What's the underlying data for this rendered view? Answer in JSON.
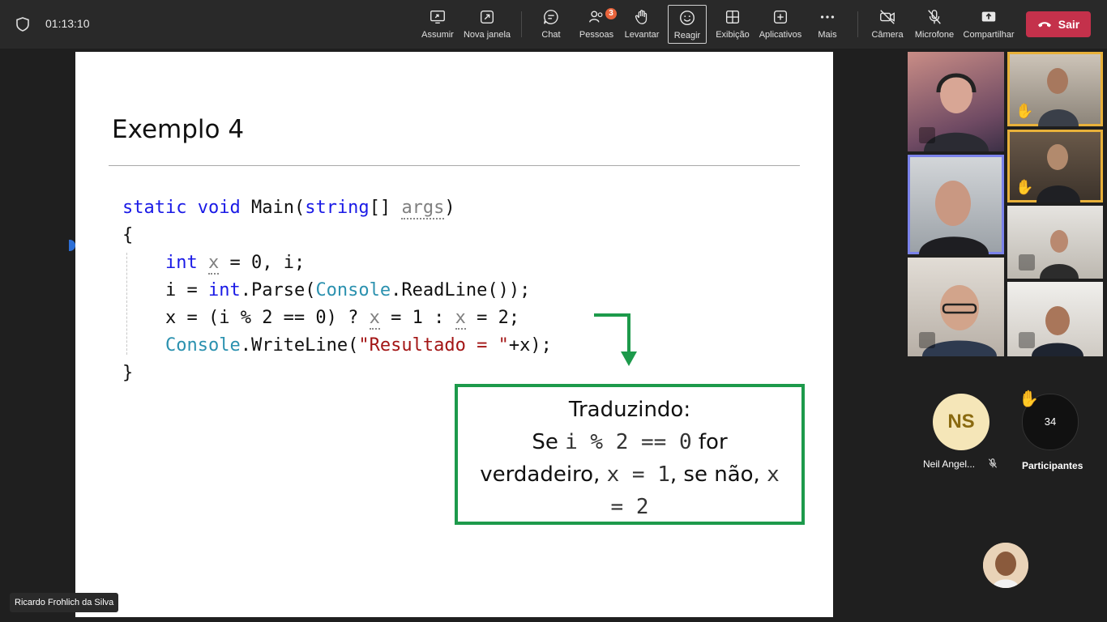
{
  "topbar": {
    "timer": "01:13:10",
    "buttons": [
      {
        "key": "assumir",
        "label": "Assumir",
        "icon": "share-screen-icon"
      },
      {
        "key": "nova_janela",
        "label": "Nova janela",
        "icon": "new-window-icon"
      },
      {
        "key": "chat",
        "label": "Chat",
        "icon": "chat-icon"
      },
      {
        "key": "pessoas",
        "label": "Pessoas",
        "icon": "people-icon",
        "badge": "3"
      },
      {
        "key": "levantar",
        "label": "Levantar",
        "icon": "raise-hand-icon"
      },
      {
        "key": "reagir",
        "label": "Reagir",
        "icon": "smiley-icon"
      },
      {
        "key": "exibicao",
        "label": "Exibição",
        "icon": "grid-icon"
      },
      {
        "key": "aplicativos",
        "label": "Aplicativos",
        "icon": "plus-box-icon"
      },
      {
        "key": "mais",
        "label": "Mais",
        "icon": "more-icon"
      },
      {
        "key": "camera",
        "label": "Câmera",
        "icon": "camera-off-icon"
      },
      {
        "key": "microfone",
        "label": "Microfone",
        "icon": "mic-off-icon"
      },
      {
        "key": "compartilhar",
        "label": "Compartilhar",
        "icon": "share-icon"
      }
    ],
    "leave_label": "Sair",
    "leave_color": "#c4314b"
  },
  "slide": {
    "title": "Exemplo 4",
    "code": {
      "l1_kw1": "static",
      "l1_kw2": "void",
      "l1_name": "Main(",
      "l1_kw3": "string",
      "l1_rest": "[] ",
      "l1_arg": "args",
      "l1_end": ")",
      "l2": "{",
      "l3_kw": "int",
      "l3_x": "x",
      "l3_rest": " = 0, i;",
      "l4_a": "i = ",
      "l4_kw": "int",
      "l4_b": ".Parse(",
      "l4_ty": "Console",
      "l4_c": ".ReadLine());",
      "l5_a": "x = (i % 2 == 0) ? ",
      "l5_x1": "x",
      "l5_b": " = 1 : ",
      "l5_x2": "x",
      "l5_c": " = 2;",
      "l6_ty": "Console",
      "l6_a": ".WriteLine(",
      "l6_str": "\"Resultado = \"",
      "l6_b": "+x);",
      "l7": "}"
    },
    "callout": {
      "line1": "Traduzindo:",
      "se": "Se",
      "cond": "i % 2 == 0",
      "for": "for",
      "verdadeiro": "verdadeiro,",
      "x1": "x = 1",
      "senao": ", se não,",
      "x2a": "x",
      "x2b": "= 2"
    },
    "accent_color": "#1d9a4b"
  },
  "presenter_name": "Ricardo Frohlich da Silva",
  "roster": {
    "ns_initials": "NS",
    "ns_name": "Neil Angel...",
    "participants_count": "34",
    "participants_label": "Participantes"
  }
}
